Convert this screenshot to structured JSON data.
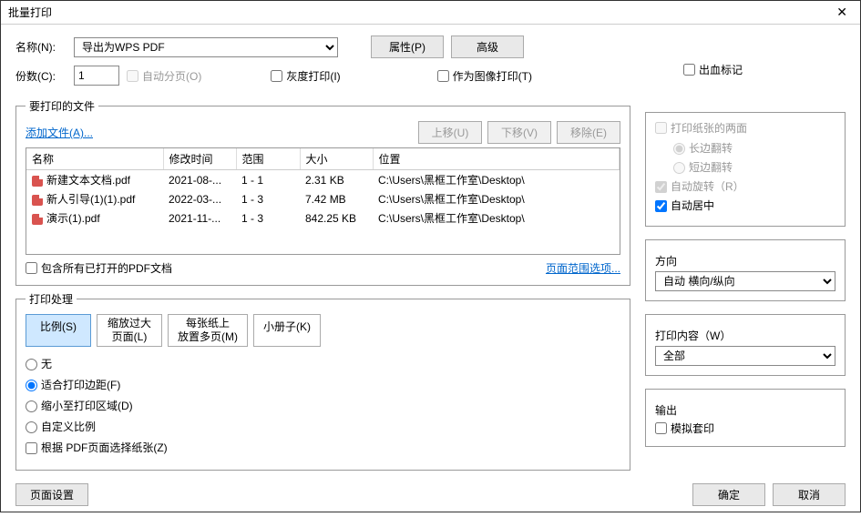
{
  "title": "批量打印",
  "labels": {
    "name": "名称(N):",
    "copies": "份数(C):",
    "autoCollate": "自动分页(O)",
    "grayscale": "灰度打印(I)",
    "printAsImage": "作为图像打印(T)",
    "bleed": "出血标记",
    "properties": "属性(P)",
    "advanced": "高级"
  },
  "printer": {
    "selected": "导出为WPS PDF",
    "copies": "1"
  },
  "files": {
    "groupTitle": "要打印的文件",
    "addFiles": "添加文件(A)...",
    "moveUp": "上移(U)",
    "moveDown": "下移(V)",
    "remove": "移除(E)",
    "columns": {
      "name": "名称",
      "modified": "修改时间",
      "range": "范围",
      "size": "大小",
      "location": "位置"
    },
    "rows": [
      {
        "name": "新建文本文档.pdf",
        "modified": "2021-08-...",
        "range": "1 - 1",
        "size": "2.31 KB",
        "location": "C:\\Users\\黑框工作室\\Desktop\\"
      },
      {
        "name": "新人引导(1)(1).pdf",
        "modified": "2022-03-...",
        "range": "1 - 3",
        "size": "7.42 MB",
        "location": "C:\\Users\\黑框工作室\\Desktop\\"
      },
      {
        "name": "演示(1).pdf",
        "modified": "2021-11-...",
        "range": "1 - 3",
        "size": "842.25 KB",
        "location": "C:\\Users\\黑框工作室\\Desktop\\"
      }
    ],
    "includeOpen": "包含所有已打开的PDF文档",
    "pageRangeOptions": "页面范围选项..."
  },
  "handling": {
    "groupTitle": "打印处理",
    "tabs": {
      "scale": "比例(S)",
      "zoomLarge1": "缩放过大",
      "zoomLarge2": "页面(L)",
      "multi1": "每张纸上",
      "multi2": "放置多页(M)",
      "booklet": "小册子(K)"
    },
    "radios": {
      "none": "无",
      "fitMargins": "适合打印边距(F)",
      "shrinkArea": "缩小至打印区域(D)",
      "custom": "自定义比例"
    },
    "paperByPage": "根据 PDF页面选择纸张(Z)"
  },
  "rightPane": {
    "bothSides": "打印纸张的两面",
    "longEdge": "长边翻转",
    "shortEdge": "短边翻转",
    "autoRotate": "自动旋转（R）",
    "autoCenter": "自动居中",
    "orientationTitle": "方向",
    "orientationValue": "自动 横向/纵向",
    "contentTitle": "打印内容（W）",
    "contentValue": "全部",
    "outputTitle": "输出",
    "simulateOverprint": "模拟套印"
  },
  "footer": {
    "pageSetup": "页面设置",
    "ok": "确定",
    "cancel": "取消"
  }
}
